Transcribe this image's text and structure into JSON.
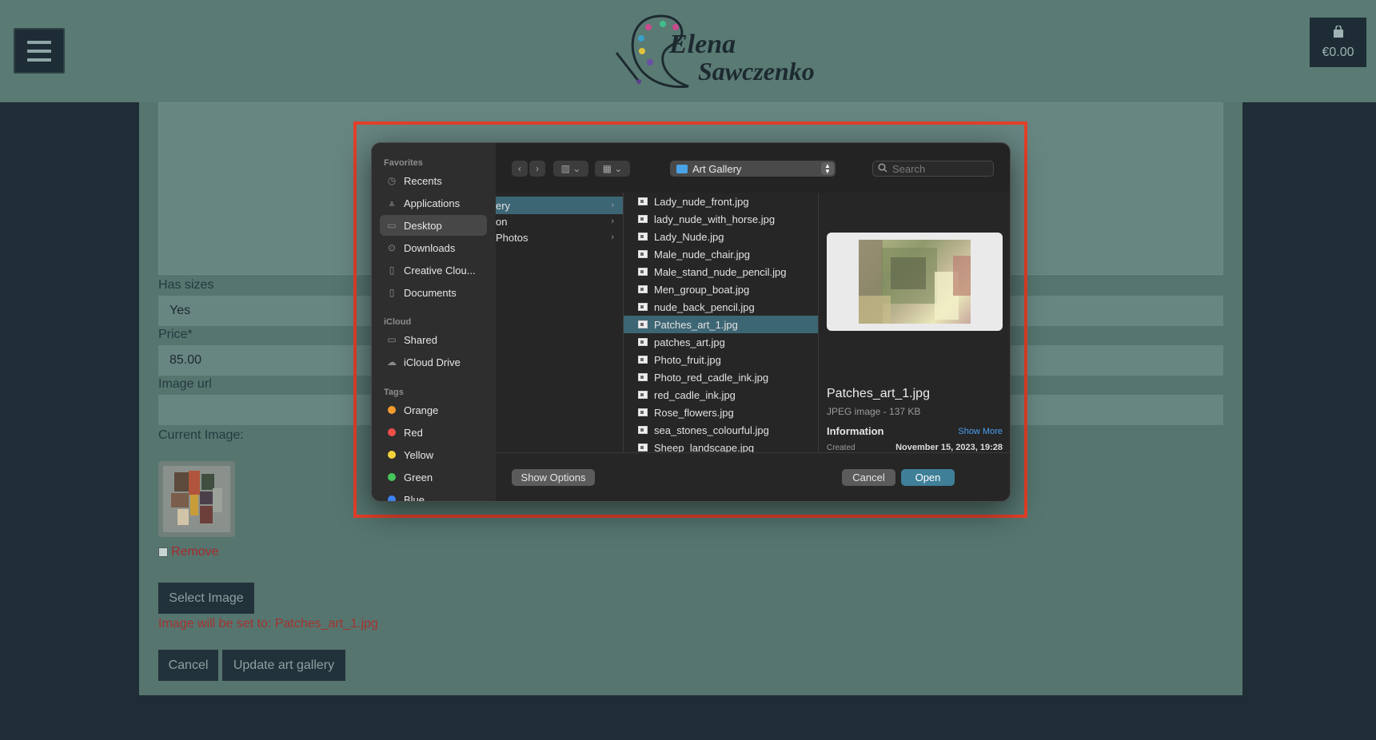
{
  "header": {
    "logo_line1": "Elena",
    "logo_line2": "Sawczenko",
    "cart_total": "€0.00"
  },
  "form": {
    "has_sizes_label": "Has sizes",
    "has_sizes_value": "Yes",
    "price_label": "Price*",
    "price_value": "85.00",
    "image_url_label": "Image url",
    "image_url_value": "",
    "current_image_label": "Current Image:",
    "remove_label": "Remove",
    "select_image_button": "Select Image",
    "image_notice": "Image will be set to: Patches_art_1.jpg",
    "cancel_button": "Cancel",
    "update_button": "Update art gallery"
  },
  "dialog": {
    "sidebar": {
      "favorites_heading": "Favorites",
      "favorites": [
        {
          "label": "Recents",
          "icon": "clock-icon"
        },
        {
          "label": "Applications",
          "icon": "applications-icon"
        },
        {
          "label": "Desktop",
          "icon": "desktop-icon",
          "selected": true
        },
        {
          "label": "Downloads",
          "icon": "download-icon"
        },
        {
          "label": "Creative Clou...",
          "icon": "document-icon"
        },
        {
          "label": "Documents",
          "icon": "document-icon"
        }
      ],
      "icloud_heading": "iCloud",
      "icloud": [
        {
          "label": "Shared",
          "icon": "shared-folder-icon"
        },
        {
          "label": "iCloud Drive",
          "icon": "cloud-icon"
        }
      ],
      "tags_heading": "Tags",
      "tags": [
        {
          "label": "Orange",
          "color": "#f39b2e"
        },
        {
          "label": "Red",
          "color": "#ee4f4a"
        },
        {
          "label": "Yellow",
          "color": "#f4d33a"
        },
        {
          "label": "Green",
          "color": "#45c65a"
        },
        {
          "label": "Blue",
          "color": "#3b82f0"
        }
      ]
    },
    "toolbar": {
      "back_glyph": "‹",
      "forward_glyph": "›",
      "view_glyph": "▥ ⌄",
      "group_glyph": "▦ ⌄",
      "location": "Art Gallery",
      "search_placeholder": "Search"
    },
    "column1": [
      {
        "label": "ery",
        "selected": true
      },
      {
        "label": "on",
        "selected": false
      },
      {
        "label": "Photos",
        "selected": false
      }
    ],
    "files": [
      "Lady_nude_front.jpg",
      "lady_nude_with_horse.jpg",
      "Lady_Nude.jpg",
      "Male_nude_chair.jpg",
      "Male_stand_nude_pencil.jpg",
      "Men_group_boat.jpg",
      "nude_back_pencil.jpg",
      "Patches_art_1.jpg",
      "patches_art.jpg",
      "Photo_fruit.jpg",
      "Photo_red_cadle_ink.jpg",
      "red_cadle_ink.jpg",
      "Rose_flowers.jpg",
      "sea_stones_colourful.jpg",
      "Sheep_landscape.jpg"
    ],
    "selected_file": "Patches_art_1.jpg",
    "preview": {
      "name": "Patches_art_1.jpg",
      "kind": "JPEG image - 137 KB",
      "info_heading": "Information",
      "show_more": "Show More",
      "created_label": "Created",
      "created_value": "November 15, 2023, 19:28"
    },
    "buttons": {
      "show_options": "Show Options",
      "cancel": "Cancel",
      "open": "Open"
    }
  }
}
